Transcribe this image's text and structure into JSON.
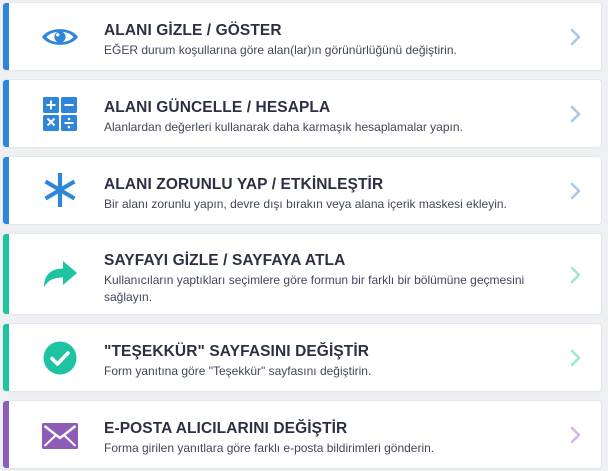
{
  "items": [
    {
      "title": "ALANI GİZLE / GÖSTER",
      "description": "EĞER durum koşullarına göre alan(lar)ın görünürlüğünü değiştirin.",
      "icon": "eye-icon",
      "accent": "#2f86d8",
      "chevron": "#a9c9e8"
    },
    {
      "title": "ALANI GÜNCELLE / HESAPLA",
      "description": "Alanlardan değerleri kullanarak daha karmaşık hesaplamalar yapın.",
      "icon": "calculator-icon",
      "accent": "#2f86d8",
      "chevron": "#a9c9e8"
    },
    {
      "title": "ALANI ZORUNLU YAP / ETKİNLEŞTİR",
      "description": "Bir alanı zorunlu yapın, devre dışı bırakın veya alana içerik maskesi ekleyin.",
      "icon": "asterisk-icon",
      "accent": "#2f86d8",
      "chevron": "#a9c9e8"
    },
    {
      "title": "SAYFAYI GİZLE / SAYFAYA ATLA",
      "description": "Kullanıcıların yaptıkları seçimlere göre formun bir farklı bir bölümüne geçmesini sağlayın.",
      "icon": "forward-arrow-icon",
      "accent": "#1ec4a1",
      "chevron": "#9fe6d5"
    },
    {
      "title": "\"TEŞEKKÜR\" SAYFASINI DEĞİŞTİR",
      "description": "Form yanıtına göre \"Teşekkür\" sayfasını değiştirin.",
      "icon": "check-circle-icon",
      "accent": "#1ec4a1",
      "chevron": "#9fe6d5"
    },
    {
      "title": "E-POSTA ALICILARINI DEĞİŞTİR",
      "description": "Forma girilen yanıtlara göre farklı e-posta bildirimleri gönderin.",
      "icon": "envelope-icon",
      "accent": "#8d5bb8",
      "chevron": "#d3b8e6"
    }
  ]
}
